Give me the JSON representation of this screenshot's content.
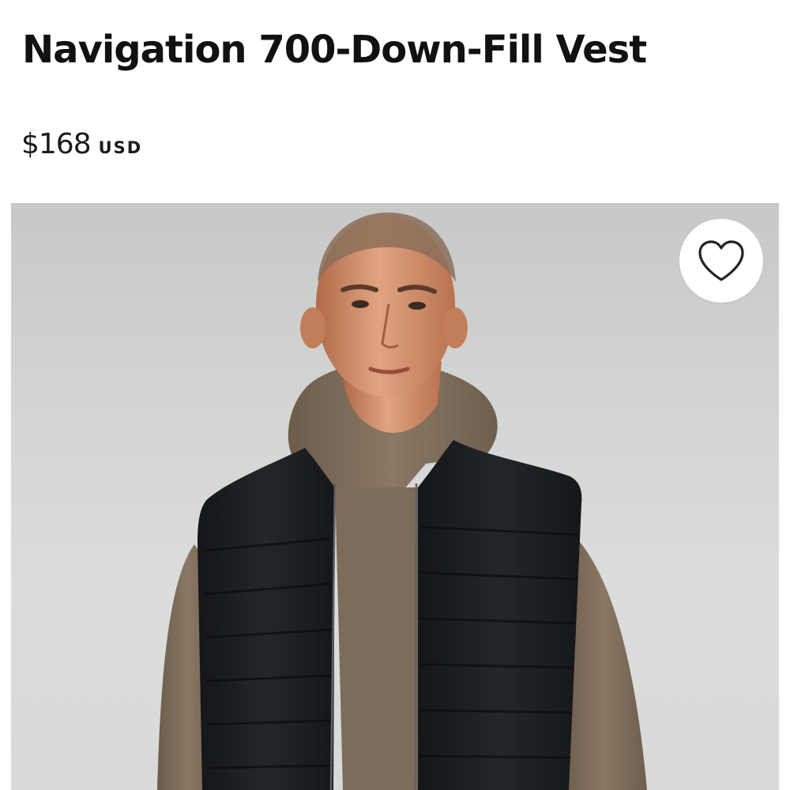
{
  "product": {
    "title": "Navigation 700-Down-Fill Vest",
    "price": "$168",
    "currency": "USD"
  },
  "image": {
    "description_icon": "product-photo",
    "background_color": "#d3d5d4",
    "vest_color": "#1c1e21",
    "hoodie_color": "#7d6c59"
  },
  "wishlist": {
    "icon": "heart-icon",
    "label": "Add to wishlist"
  }
}
